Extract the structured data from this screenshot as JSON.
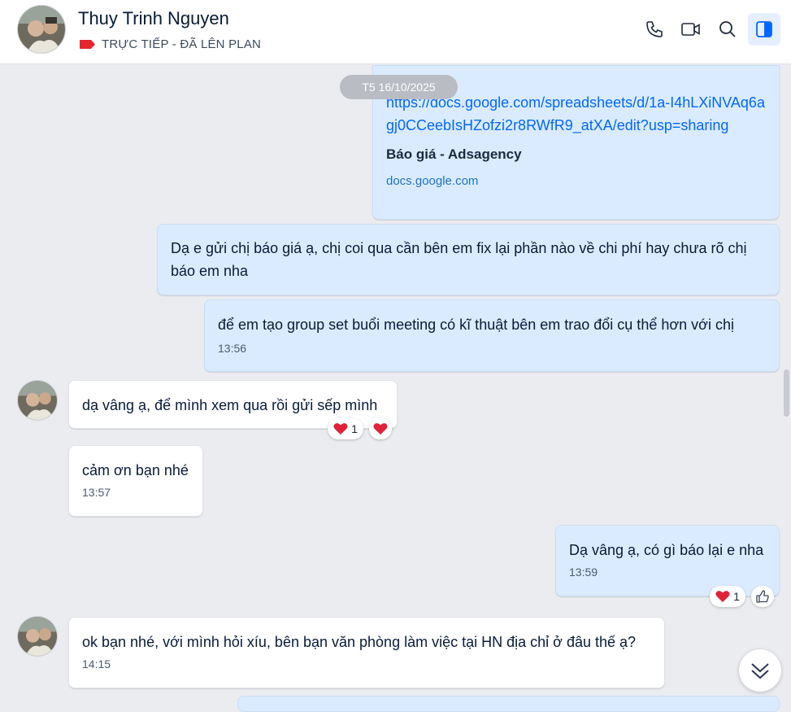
{
  "header": {
    "contact_name": "Thuy Trinh Nguyen",
    "tag_label": "TRỰC TIẾP - ĐÃ LÊN PLAN",
    "tag_color": "#e5262e",
    "actions": [
      "phone-icon",
      "video-icon",
      "search-icon",
      "sidebar-toggle-icon"
    ]
  },
  "date_divider": "T5 16/10/2025",
  "messages": {
    "link_card": {
      "url": "https://docs.google.com/spreadsheets/d/1a-I4hLXiNVAq6agj0CCeebIsHZofzi2r8RWfR9_atXA/edit?usp=sharing",
      "title": "Báo giá - Adsagency",
      "domain": "docs.google.com"
    },
    "m1": {
      "text": "Dạ e gửi chị báo giá ạ, chị coi qua cần bên em fix lại phần nào về chi phí hay chưa rõ chị báo em nha"
    },
    "m2": {
      "text": "để em tạo group set buổi meeting có kĩ thuật bên em trao đổi cụ thể hơn với chị",
      "time": "13:56"
    },
    "m3": {
      "text": "dạ vâng ạ, để mình xem qua rồi gửi sếp mình",
      "reaction_count": "1"
    },
    "m4": {
      "text": "cảm ơn bạn nhé",
      "time": "13:57"
    },
    "m5": {
      "text": "Dạ vâng ạ, có gì báo lại e nha",
      "time": "13:59",
      "reaction_count": "1"
    },
    "m6": {
      "text": "ok bạn nhé, với mình hỏi xíu, bên bạn văn phòng làm việc tại HN địa chỉ ở đâu thế ạ?",
      "time": "14:15"
    }
  },
  "colors": {
    "accent": "#0068ff",
    "my_bubble": "#dbebff",
    "heart": "#e0213a"
  }
}
